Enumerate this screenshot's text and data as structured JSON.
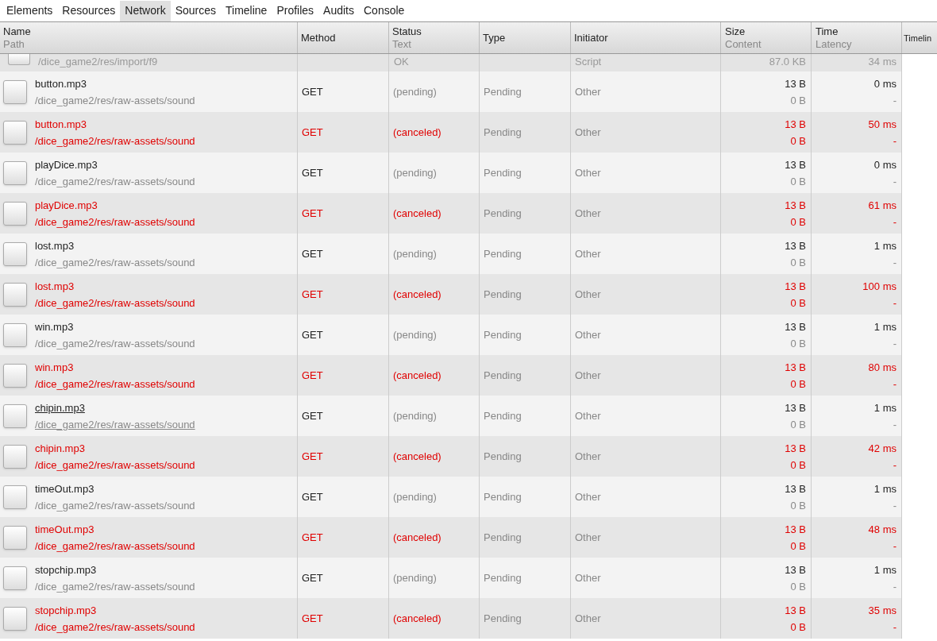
{
  "tabs": [
    {
      "label": "Elements",
      "selected": false
    },
    {
      "label": "Resources",
      "selected": false
    },
    {
      "label": "Network",
      "selected": true
    },
    {
      "label": "Sources",
      "selected": false
    },
    {
      "label": "Timeline",
      "selected": false
    },
    {
      "label": "Profiles",
      "selected": false
    },
    {
      "label": "Audits",
      "selected": false
    },
    {
      "label": "Console",
      "selected": false
    }
  ],
  "columns": [
    {
      "title": "Name",
      "subtitle": "Path"
    },
    {
      "title": "Method"
    },
    {
      "title": "Status",
      "subtitle": "Text"
    },
    {
      "title": "Type"
    },
    {
      "title": "Initiator"
    },
    {
      "title": "Size",
      "subtitle": "Content"
    },
    {
      "title": "Time",
      "subtitle": "Latency"
    },
    {
      "title": "Timelin"
    }
  ],
  "partial_row": {
    "path": "/dice_game2/res/import/f9",
    "status_text": "OK",
    "initiator": "Script",
    "content": "87.0 KB",
    "latency": "34 ms"
  },
  "rows": [
    {
      "name": "button.mp3",
      "path": "/dice_game2/res/raw-assets/sound",
      "method": "GET",
      "status": "(pending)",
      "type": "Pending",
      "initiator": "Other",
      "size": "13 B",
      "content": "0 B",
      "time": "0 ms",
      "latency": "-",
      "canceled": false,
      "hovered": false
    },
    {
      "name": "button.mp3",
      "path": "/dice_game2/res/raw-assets/sound",
      "method": "GET",
      "status": "(canceled)",
      "type": "Pending",
      "initiator": "Other",
      "size": "13 B",
      "content": "0 B",
      "time": "50 ms",
      "latency": "-",
      "canceled": true,
      "hovered": false
    },
    {
      "name": "playDice.mp3",
      "path": "/dice_game2/res/raw-assets/sound",
      "method": "GET",
      "status": "(pending)",
      "type": "Pending",
      "initiator": "Other",
      "size": "13 B",
      "content": "0 B",
      "time": "0 ms",
      "latency": "-",
      "canceled": false,
      "hovered": false
    },
    {
      "name": "playDice.mp3",
      "path": "/dice_game2/res/raw-assets/sound",
      "method": "GET",
      "status": "(canceled)",
      "type": "Pending",
      "initiator": "Other",
      "size": "13 B",
      "content": "0 B",
      "time": "61 ms",
      "latency": "-",
      "canceled": true,
      "hovered": false
    },
    {
      "name": "lost.mp3",
      "path": "/dice_game2/res/raw-assets/sound",
      "method": "GET",
      "status": "(pending)",
      "type": "Pending",
      "initiator": "Other",
      "size": "13 B",
      "content": "0 B",
      "time": "1 ms",
      "latency": "-",
      "canceled": false,
      "hovered": false
    },
    {
      "name": "lost.mp3",
      "path": "/dice_game2/res/raw-assets/sound",
      "method": "GET",
      "status": "(canceled)",
      "type": "Pending",
      "initiator": "Other",
      "size": "13 B",
      "content": "0 B",
      "time": "100 ms",
      "latency": "-",
      "canceled": true,
      "hovered": false
    },
    {
      "name": "win.mp3",
      "path": "/dice_game2/res/raw-assets/sound",
      "method": "GET",
      "status": "(pending)",
      "type": "Pending",
      "initiator": "Other",
      "size": "13 B",
      "content": "0 B",
      "time": "1 ms",
      "latency": "-",
      "canceled": false,
      "hovered": false
    },
    {
      "name": "win.mp3",
      "path": "/dice_game2/res/raw-assets/sound",
      "method": "GET",
      "status": "(canceled)",
      "type": "Pending",
      "initiator": "Other",
      "size": "13 B",
      "content": "0 B",
      "time": "80 ms",
      "latency": "-",
      "canceled": true,
      "hovered": false
    },
    {
      "name": "chipin.mp3",
      "path": "/dice_game2/res/raw-assets/sound",
      "method": "GET",
      "status": "(pending)",
      "type": "Pending",
      "initiator": "Other",
      "size": "13 B",
      "content": "0 B",
      "time": "1 ms",
      "latency": "-",
      "canceled": false,
      "hovered": true
    },
    {
      "name": "chipin.mp3",
      "path": "/dice_game2/res/raw-assets/sound",
      "method": "GET",
      "status": "(canceled)",
      "type": "Pending",
      "initiator": "Other",
      "size": "13 B",
      "content": "0 B",
      "time": "42 ms",
      "latency": "-",
      "canceled": true,
      "hovered": false
    },
    {
      "name": "timeOut.mp3",
      "path": "/dice_game2/res/raw-assets/sound",
      "method": "GET",
      "status": "(pending)",
      "type": "Pending",
      "initiator": "Other",
      "size": "13 B",
      "content": "0 B",
      "time": "1 ms",
      "latency": "-",
      "canceled": false,
      "hovered": false
    },
    {
      "name": "timeOut.mp3",
      "path": "/dice_game2/res/raw-assets/sound",
      "method": "GET",
      "status": "(canceled)",
      "type": "Pending",
      "initiator": "Other",
      "size": "13 B",
      "content": "0 B",
      "time": "48 ms",
      "latency": "-",
      "canceled": true,
      "hovered": false
    },
    {
      "name": "stopchip.mp3",
      "path": "/dice_game2/res/raw-assets/sound",
      "method": "GET",
      "status": "(pending)",
      "type": "Pending",
      "initiator": "Other",
      "size": "13 B",
      "content": "0 B",
      "time": "1 ms",
      "latency": "-",
      "canceled": false,
      "hovered": false
    },
    {
      "name": "stopchip.mp3",
      "path": "/dice_game2/res/raw-assets/sound",
      "method": "GET",
      "status": "(canceled)",
      "type": "Pending",
      "initiator": "Other",
      "size": "13 B",
      "content": "0 B",
      "time": "35 ms",
      "latency": "-",
      "canceled": true,
      "hovered": false
    }
  ]
}
